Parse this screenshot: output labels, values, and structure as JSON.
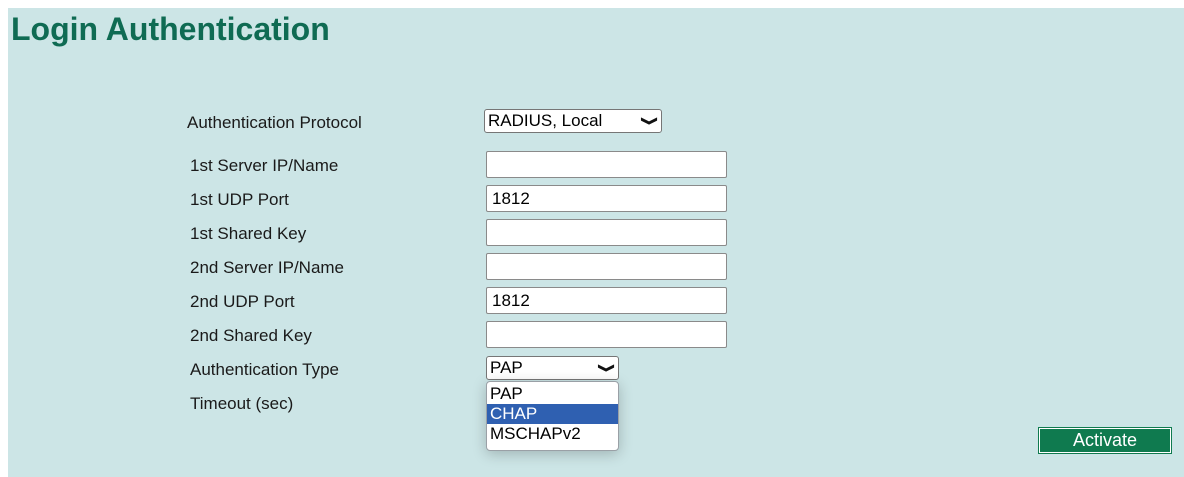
{
  "page": {
    "title": "Login Authentication"
  },
  "form": {
    "auth_protocol": {
      "label": "Authentication Protocol",
      "value": "RADIUS, Local"
    },
    "server1_ip": {
      "label": "1st Server IP/Name",
      "value": ""
    },
    "udp_port1": {
      "label": "1st UDP Port",
      "value": "1812"
    },
    "shared_key1": {
      "label": "1st Shared Key",
      "value": ""
    },
    "server2_ip": {
      "label": "2nd Server IP/Name",
      "value": ""
    },
    "udp_port2": {
      "label": "2nd UDP Port",
      "value": "1812"
    },
    "shared_key2": {
      "label": "2nd Shared Key",
      "value": ""
    },
    "auth_type": {
      "label": "Authentication Type",
      "value": "PAP",
      "options": [
        "PAP",
        "CHAP",
        "MSCHAPv2"
      ],
      "highlighted": "CHAP"
    },
    "timeout": {
      "label": "Timeout (sec)"
    }
  },
  "actions": {
    "activate_label": "Activate"
  },
  "icons": {
    "select_arrow": "chevron-down-icon"
  },
  "colors": {
    "panel_bg": "#cce5e6",
    "title": "#0f6b53",
    "button_bg": "#0f7a4f",
    "highlight": "#2f60b1"
  }
}
